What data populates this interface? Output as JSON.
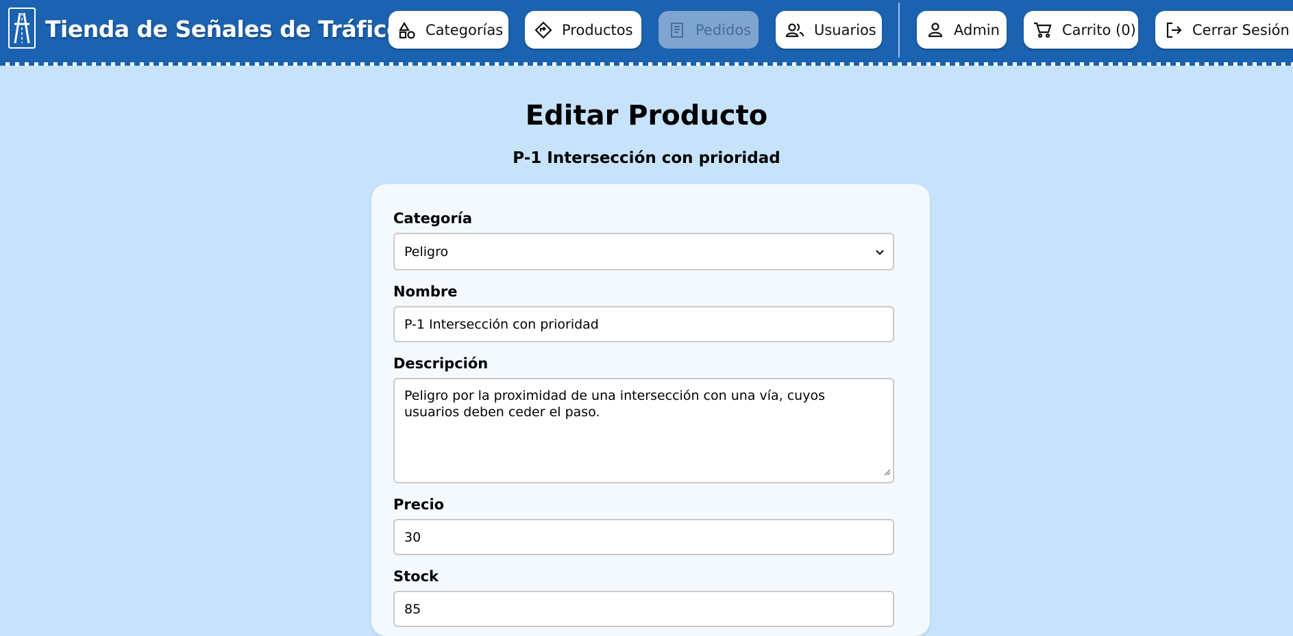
{
  "header": {
    "brand": "Tienda de Señales de Tráfico",
    "logo_icon": "motorway-road-icon",
    "nav": [
      {
        "label": "Categorías",
        "icon": "shapes-icon",
        "disabled": false
      },
      {
        "label": "Productos",
        "icon": "diamond-sign-icon",
        "disabled": false
      },
      {
        "label": "Pedidos",
        "icon": "receipt-icon",
        "disabled": true
      },
      {
        "label": "Usuarios",
        "icon": "users-icon",
        "disabled": false
      }
    ],
    "user_nav": [
      {
        "label": "Admin",
        "icon": "user-icon"
      },
      {
        "label": "Carrito (0)",
        "icon": "cart-icon"
      },
      {
        "label": "Cerrar Sesión",
        "icon": "logout-icon"
      }
    ],
    "colors": {
      "bar": "#1b63b0",
      "page_bg": "#c7e3fb",
      "disabled_btn": "#7ea4d0"
    }
  },
  "main": {
    "title": "Editar Producto",
    "subtitle": "P-1 Intersección con prioridad",
    "form": {
      "categoria_label": "Categoría",
      "categoria_value": "Peligro",
      "nombre_label": "Nombre",
      "nombre_value": "P-1 Intersección con prioridad",
      "descripcion_label": "Descripción",
      "descripcion_value": "Peligro por la proximidad de una intersección con una vía, cuyos usuarios deben ceder el paso.",
      "precio_label": "Precio",
      "precio_value": "30",
      "stock_label": "Stock",
      "stock_value": "85"
    }
  }
}
